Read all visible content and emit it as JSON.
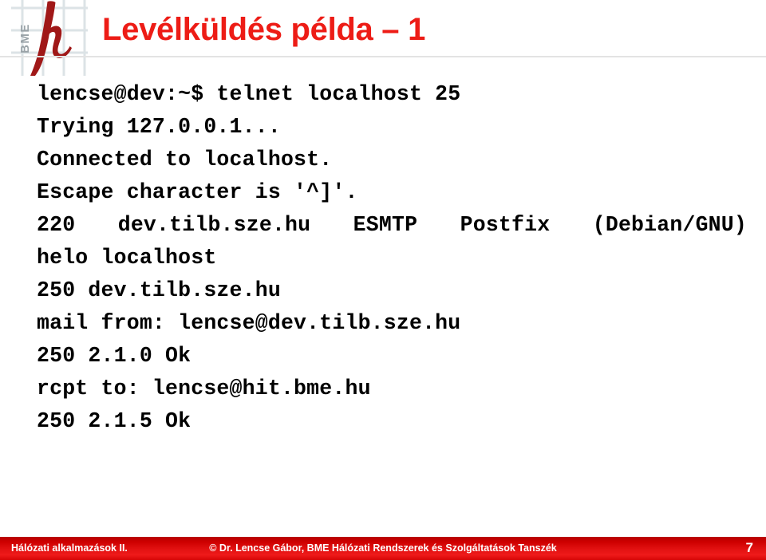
{
  "slide": {
    "title": "Levélküldés példa – 1",
    "title_color": "#ED1C16"
  },
  "logo": {
    "name": "bme-logo",
    "wordmark": "BME",
    "glyph": "h",
    "wordmark_color": "#9AA3A8",
    "glyph_color": "#A01818",
    "grid_color": "#DCE3E6"
  },
  "terminal": {
    "lines": [
      "lencse@dev:~$ telnet localhost 25",
      "Trying 127.0.0.1...",
      "Connected to localhost.",
      "Escape character is '^]'.",
      "220 dev.tilb.sze.hu ESMTP Postfix (Debian/GNU)",
      "helo localhost",
      "250 dev.tilb.sze.hu",
      "mail from: lencse@dev.tilb.sze.hu",
      "250 2.1.0 Ok",
      "rcpt to: lencse@hit.bme.hu",
      "250 2.1.5 Ok"
    ]
  },
  "footer": {
    "course": "Hálózati alkalmazások II.",
    "credit": "© Dr. Lencse Gábor, BME Hálózati Rendszerek és Szolgáltatások Tanszék",
    "page_number": "7",
    "background_color": "#D40000",
    "text_color": "#FFFFFF"
  }
}
